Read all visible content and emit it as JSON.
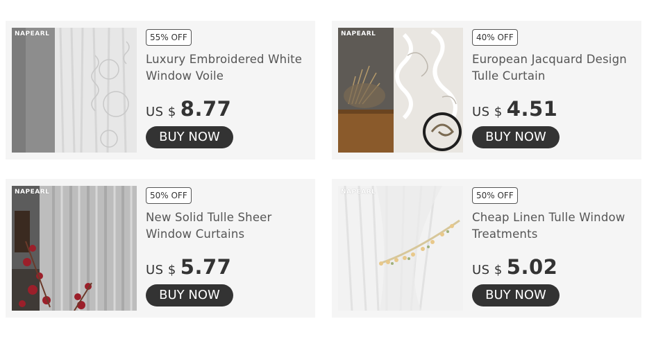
{
  "products": [
    {
      "brand": "NAPEARL",
      "discount": "55% OFF",
      "title": "Luxury Embroidered White Window Voile",
      "currency": "US $",
      "price": "8.77",
      "button": "BUY NOW"
    },
    {
      "brand": "NAPEARL",
      "discount": "40% OFF",
      "title": "European Jacquard Design Tulle Curtain",
      "currency": "US $",
      "price": "4.51",
      "button": "BUY NOW"
    },
    {
      "brand": "NAPEARL",
      "discount": "50% OFF",
      "title": "New Solid Tulle Sheer Window Curtains",
      "currency": "US $",
      "price": "5.77",
      "button": "BUY NOW"
    },
    {
      "brand": "NAPEARL",
      "discount": "50% OFF",
      "title": "Cheap Linen Tulle Window Treatments",
      "currency": "US $",
      "price": "5.02",
      "button": "BUY NOW"
    }
  ],
  "colors": {
    "card_bg": "#f5f5f5",
    "button_bg": "#333333",
    "button_text": "#ffffff"
  }
}
